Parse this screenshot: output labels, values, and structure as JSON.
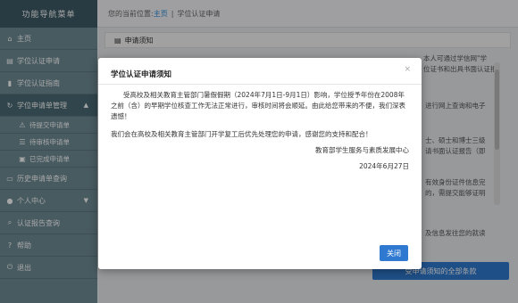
{
  "sidebar": {
    "title": "功能导航菜单",
    "items": [
      {
        "label": "主页",
        "icon": "home-icon"
      },
      {
        "label": "学位认证申请",
        "icon": "document-icon"
      },
      {
        "label": "学位认证指南",
        "icon": "bookmark-icon"
      },
      {
        "label": "学位申请单管理",
        "icon": "refresh-icon",
        "expanded": true
      },
      {
        "label": "待提交申请单",
        "icon": "warning-icon"
      },
      {
        "label": "待审核申请单",
        "icon": "list-icon"
      },
      {
        "label": "已完成申请单",
        "icon": "inbox-icon"
      },
      {
        "label": "历史申请单查询",
        "icon": "history-icon"
      },
      {
        "label": "个人中心",
        "icon": "user-icon"
      },
      {
        "label": "认证报告查询",
        "icon": "search-icon"
      },
      {
        "label": "帮助",
        "icon": "help-icon"
      },
      {
        "label": "退出",
        "icon": "power-icon"
      }
    ]
  },
  "breadcrumb": {
    "prefix": "您的当前位置:",
    "home": "主页",
    "separator": "|",
    "current": "学位认证申请"
  },
  "panel": {
    "title": "申请须知"
  },
  "background_text": {
    "line1": "本人可通过学信网\"学",
    "line2": "位证书和出具书面认证报",
    "line3": "进行网上查询和电子",
    "line4": "士、硕士和博士三级",
    "line5": "请书面认证报告（即",
    "line6": "有效身份证件信息完",
    "line7": "的，需提交能够证明",
    "line8": "及信息发往您的就读",
    "button": "受申请须知的全部条款"
  },
  "modal": {
    "title": "学位认证申请须知",
    "close": "×",
    "para1": "受高校及相关教育主管部门暑假假期（2024年7月1日-9月1日）影响，学位授予年份在2008年之前（含）的早期学位核查工作无法正常进行，审核时间将会顺延。由此给您带来的不便，我们深表遗憾！",
    "para2": "我们会在高校及相关教育主管部门开学复工后优先处理您的申请，感谢您的支持和配合！",
    "signature": "教育部学生服务与素质发展中心",
    "date": "2024年6月27日",
    "close_button": "关闭"
  },
  "colors": {
    "sidebar": "#6f8d96",
    "sidebar_header": "#3e5b66",
    "accent": "#2f7ad0"
  }
}
